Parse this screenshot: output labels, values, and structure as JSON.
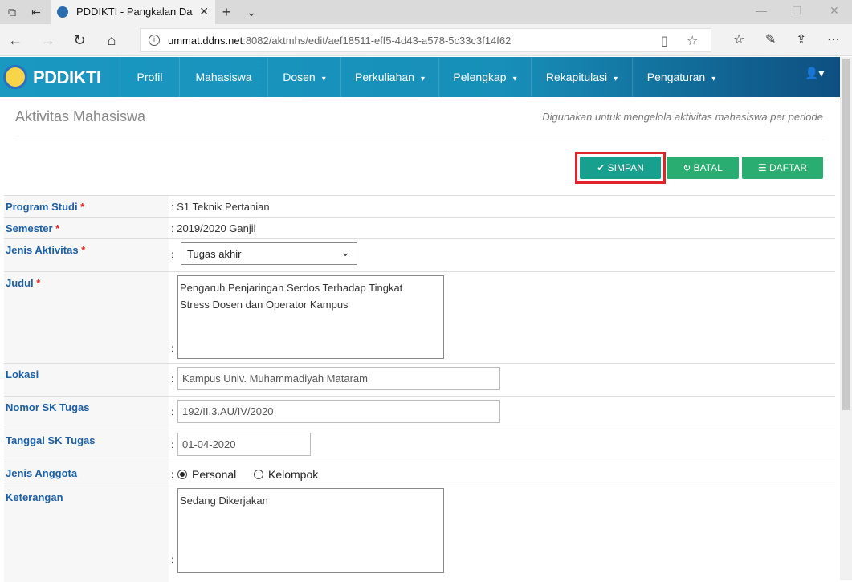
{
  "browser": {
    "tab_title": "PDDIKTI - Pangkalan Da",
    "url_host": "ummat.ddns.net",
    "url_path": ":8082/aktmhs/edit/aef18511-eff5-4d43-a578-5c33c3f14f62"
  },
  "nav": {
    "logo": "PDDIKTI",
    "items": [
      {
        "label": "Profil",
        "dropdown": false
      },
      {
        "label": "Mahasiswa",
        "dropdown": false
      },
      {
        "label": "Dosen",
        "dropdown": true
      },
      {
        "label": "Perkuliahan",
        "dropdown": true
      },
      {
        "label": "Pelengkap",
        "dropdown": true
      },
      {
        "label": "Rekapitulasi",
        "dropdown": true
      },
      {
        "label": "Pengaturan",
        "dropdown": true
      }
    ]
  },
  "page": {
    "title": "Aktivitas Mahasiswa",
    "description": "Digunakan untuk mengelola aktivitas mahasiswa per periode"
  },
  "actions": {
    "save": "SIMPAN",
    "cancel": "BATAL",
    "list": "DAFTAR"
  },
  "form": {
    "program_studi": {
      "label": "Program Studi",
      "required": "*",
      "value": ": S1 Teknik Pertanian"
    },
    "semester": {
      "label": "Semester",
      "required": "*",
      "value": ": 2019/2020 Ganjil"
    },
    "jenis_aktivitas": {
      "label": "Jenis Aktivitas",
      "required": "*",
      "value": "Tugas akhir"
    },
    "judul": {
      "label": "Judul",
      "required": "*",
      "line1": "Pengaruh Penjaringan Serdos Terhadap Tingkat",
      "line2": "Stress Dosen dan Operator Kampus"
    },
    "lokasi": {
      "label": "Lokasi",
      "value": "Kampus Univ. Muhammadiyah Mataram"
    },
    "nomor_sk": {
      "label": "Nomor SK Tugas",
      "value": "192/II.3.AU/IV/2020"
    },
    "tanggal_sk": {
      "label": "Tanggal SK Tugas",
      "value": "01-04-2020"
    },
    "jenis_anggota": {
      "label": "Jenis Anggota",
      "options": [
        "Personal",
        "Kelompok"
      ],
      "selected": "Personal"
    },
    "keterangan": {
      "label": "Keterangan",
      "value": "Sedang Dikerjakan"
    },
    "colon": ":"
  },
  "colors": {
    "nav": "#1a98c2",
    "save": "#18a08f",
    "button": "#2aad70",
    "label": "#1c5fa3",
    "highlight": "#e0242b"
  }
}
